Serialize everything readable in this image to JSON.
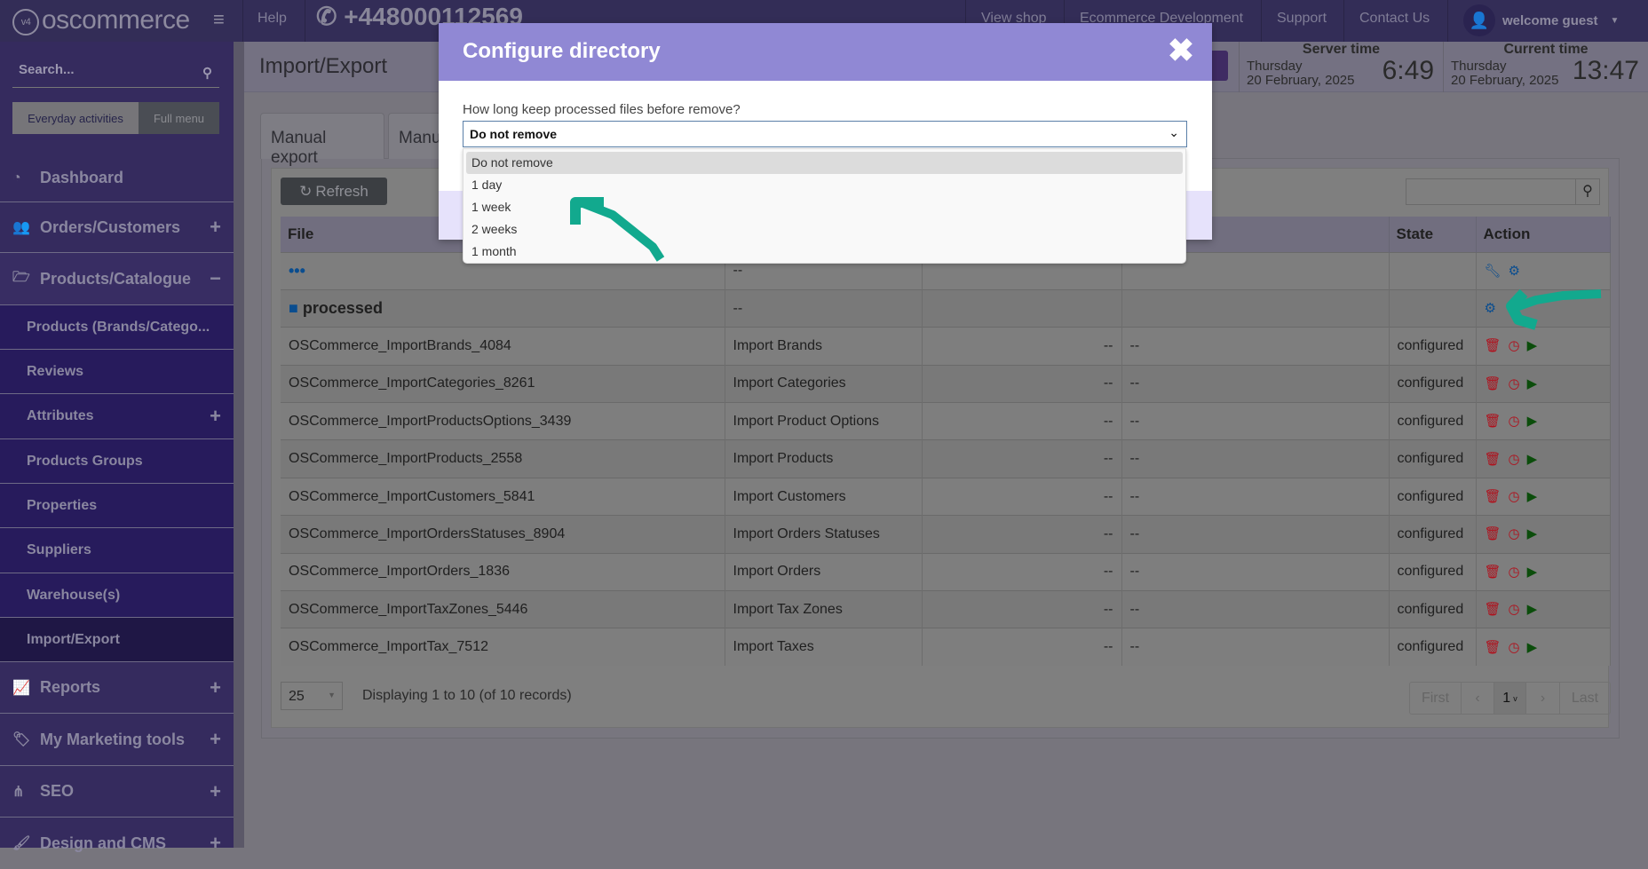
{
  "topbar": {
    "logo": "oscommerce",
    "logo_badge": "v4",
    "help": "Help",
    "phone": "+448000112569",
    "links": [
      "View shop",
      "Ecommerce Development",
      "Support",
      "Contact Us"
    ],
    "user": "welcome guest"
  },
  "sidebar": {
    "search_placeholder": "Search...",
    "mode_buttons": [
      "Everyday activities",
      "Full menu"
    ],
    "items": [
      {
        "label": "Dashboard",
        "icon": "dashboard-icon"
      },
      {
        "label": "Orders/Customers",
        "icon": "users-icon",
        "toggle": "+"
      },
      {
        "label": "Products/Catalogue",
        "icon": "folder-open-icon",
        "toggle": "−"
      }
    ],
    "subitems": [
      {
        "label": "Products (Brands/Catego..."
      },
      {
        "label": "Reviews"
      },
      {
        "label": "Attributes",
        "toggle": "+"
      },
      {
        "label": "Products Groups"
      },
      {
        "label": "Properties"
      },
      {
        "label": "Suppliers"
      },
      {
        "label": "Warehouse(s)"
      },
      {
        "label": "Import/Export",
        "active": true
      }
    ],
    "items_after": [
      {
        "label": "Reports",
        "icon": "chart-icon",
        "toggle": "+"
      },
      {
        "label": "My Marketing tools",
        "icon": "tag-icon",
        "toggle": "+"
      },
      {
        "label": "SEO",
        "icon": "sitemap-icon",
        "toggle": "+"
      },
      {
        "label": "Design and CMS",
        "icon": "brush-icon",
        "toggle": "+"
      }
    ]
  },
  "page": {
    "title": "Import/Export",
    "server_time": {
      "label": "Server time",
      "day": "Thursday",
      "date": "20 February, 2025",
      "time": "6:49"
    },
    "current_time": {
      "label": "Current time",
      "day": "Thursday",
      "date": "20 February, 2025",
      "time": "13:47"
    },
    "tabs": [
      "Manual export",
      "Manu"
    ],
    "refresh": "Refresh",
    "table": {
      "headers": [
        "File",
        "",
        "",
        "",
        "State",
        "Action"
      ],
      "rows": [
        {
          "file": "OSCommerce_ImportBrands_4084",
          "type": "Import Brands",
          "c3": "--",
          "c4": "--",
          "state": "configured"
        },
        {
          "file": "OSCommerce_ImportCategories_8261",
          "type": "Import Categories",
          "c3": "--",
          "c4": "--",
          "state": "configured"
        },
        {
          "file": "OSCommerce_ImportProductsOptions_3439",
          "type": "Import Product Options",
          "c3": "--",
          "c4": "--",
          "state": "configured"
        },
        {
          "file": "OSCommerce_ImportProducts_2558",
          "type": "Import Products",
          "c3": "--",
          "c4": "--",
          "state": "configured"
        },
        {
          "file": "OSCommerce_ImportCustomers_5841",
          "type": "Import Customers",
          "c3": "--",
          "c4": "--",
          "state": "configured"
        },
        {
          "file": "OSCommerce_ImportOrdersStatuses_8904",
          "type": "Import Orders Statuses",
          "c3": "--",
          "c4": "--",
          "state": "configured"
        },
        {
          "file": "OSCommerce_ImportOrders_1836",
          "type": "Import Orders",
          "c3": "--",
          "c4": "--",
          "state": "configured"
        },
        {
          "file": "OSCommerce_ImportTaxZones_5446",
          "type": "Import Tax Zones",
          "c3": "--",
          "c4": "--",
          "state": "configured"
        },
        {
          "file": "OSCommerce_ImportTax_7512",
          "type": "Import Taxes",
          "c3": "--",
          "c4": "--",
          "state": "configured"
        }
      ],
      "parent_row": {
        "file": "•••",
        "type": "--"
      },
      "folder_row": {
        "file": "processed",
        "type": "--"
      }
    },
    "per_page": "25",
    "displaying": "Displaying 1 to 10 (of 10 records)",
    "pager": {
      "first": "First",
      "page": "1",
      "last": "Last"
    }
  },
  "modal": {
    "title": "Configure directory",
    "label": "How long keep processed files before remove?",
    "selected": "Do not remove",
    "options": [
      "Do not remove",
      "1 day",
      "1 week",
      "2 weeks",
      "1 month"
    ]
  },
  "colors": {
    "annotation_arrow": "#12a98e",
    "modal_header": "#9088d4",
    "sidebar": "#352b5e"
  }
}
